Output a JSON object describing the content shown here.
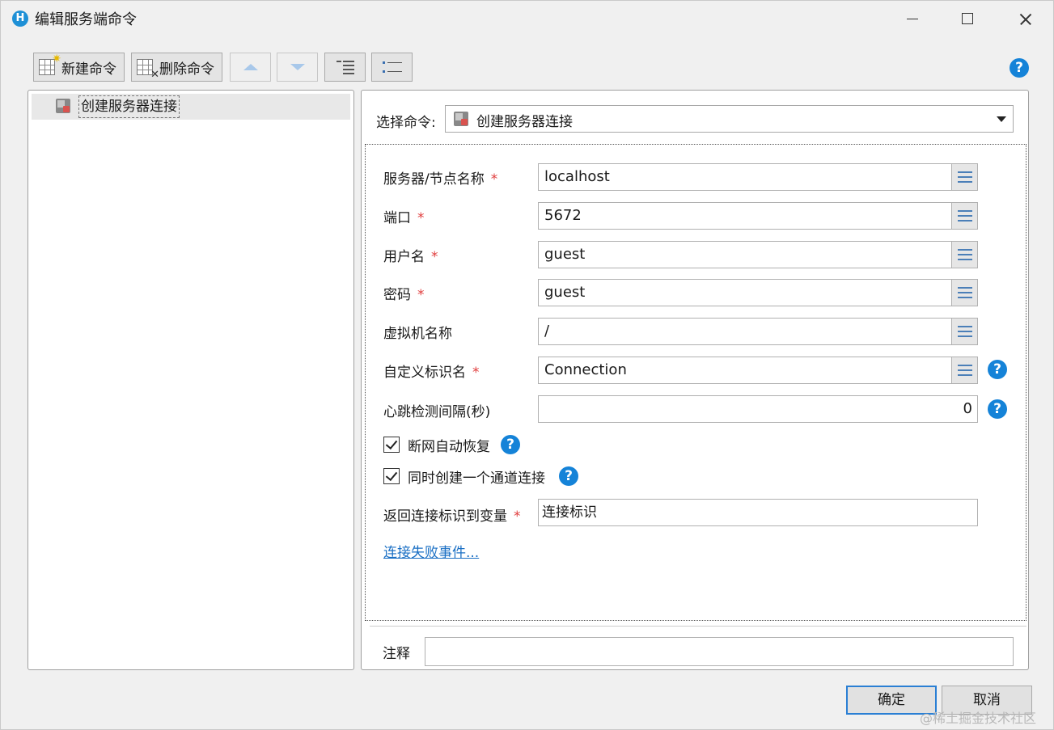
{
  "window": {
    "title": "编辑服务端命令",
    "app_icon_letter": "H"
  },
  "toolbar": {
    "new_label": "新建命令",
    "delete_label": "删除命令"
  },
  "tree": {
    "items": [
      {
        "label": "创建服务器连接"
      }
    ]
  },
  "command": {
    "select_label": "选择命令:",
    "selected": "创建服务器连接"
  },
  "form": {
    "server": {
      "label": "服务器/节点名称",
      "required": "*",
      "value": "localhost"
    },
    "port": {
      "label": "端口",
      "required": "*",
      "value": "5672"
    },
    "username": {
      "label": "用户名",
      "required": "*",
      "value": "guest"
    },
    "password": {
      "label": "密码",
      "required": "*",
      "value": "guest"
    },
    "vhost": {
      "label": "虚拟机名称",
      "value": "/"
    },
    "custom_id": {
      "label": "自定义标识名",
      "required": "*",
      "value": "Connection"
    },
    "heartbeat": {
      "label": "心跳检测间隔(秒)",
      "value": "0"
    },
    "auto_recover": {
      "label": "断网自动恢复",
      "checked": true
    },
    "create_channel": {
      "label": "同时创建一个通道连接",
      "checked": true
    },
    "return_var": {
      "label": "返回连接标识到变量",
      "required": "*",
      "value": "连接标识"
    },
    "fail_event_link": "连接失败事件..."
  },
  "note": {
    "label": "注释",
    "value": ""
  },
  "footer": {
    "ok_label": "确定",
    "cancel_label": "取消"
  },
  "watermark": "@稀土掘金技术社区",
  "colors": {
    "accent": "#1583d8",
    "required": "#e03c3c",
    "link": "#1a6fc4"
  }
}
